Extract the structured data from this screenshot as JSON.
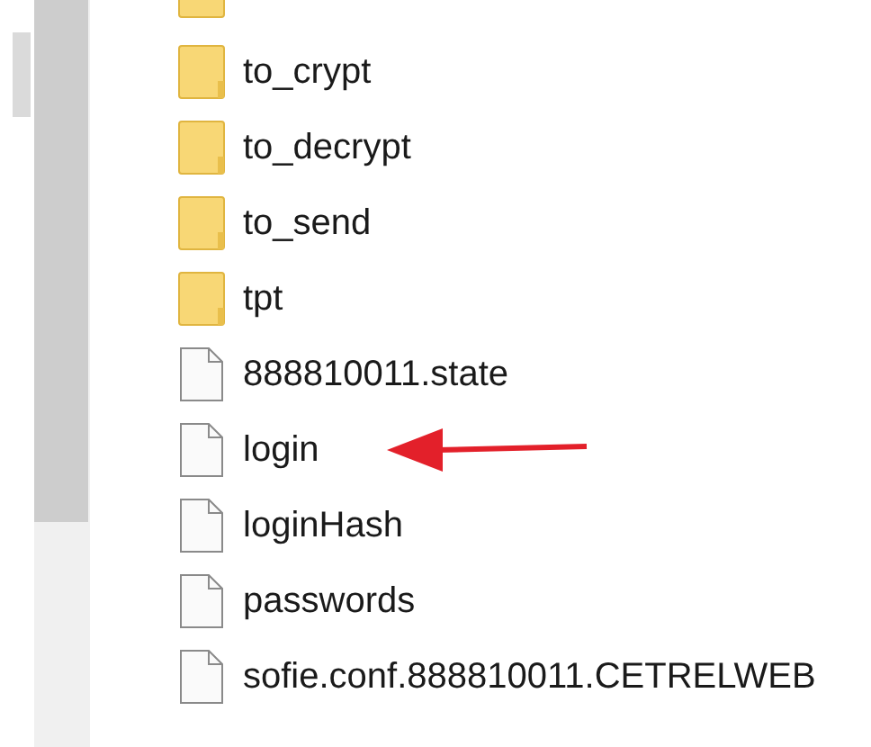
{
  "files": [
    {
      "kind": "folder",
      "name": "to_crypt",
      "marked": false
    },
    {
      "kind": "folder",
      "name": "to_decrypt",
      "marked": false
    },
    {
      "kind": "folder",
      "name": "to_send",
      "marked": false
    },
    {
      "kind": "folder",
      "name": "tpt",
      "marked": false
    },
    {
      "kind": "file",
      "name": "888810011.state",
      "marked": false
    },
    {
      "kind": "file",
      "name": "login",
      "marked": true
    },
    {
      "kind": "file",
      "name": "loginHash",
      "marked": false
    },
    {
      "kind": "file",
      "name": "passwords",
      "marked": false
    },
    {
      "kind": "file",
      "name": "sofie.conf.888810011.CETRELWEB",
      "marked": false
    }
  ]
}
